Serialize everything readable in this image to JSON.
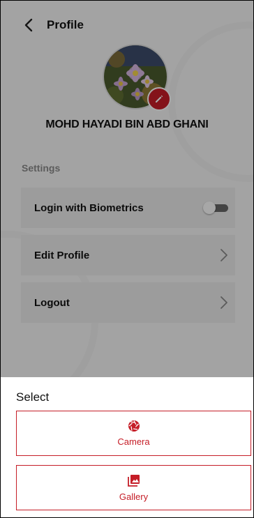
{
  "header": {
    "title": "Profile"
  },
  "profile": {
    "name": "MOHD HAYADI BIN ABD GHANI"
  },
  "settings": {
    "label": "Settings",
    "items": [
      {
        "label": "Login with Biometrics",
        "control": "toggle",
        "toggle_on": false
      },
      {
        "label": "Edit Profile",
        "control": "chevron"
      },
      {
        "label": "Logout",
        "control": "chevron"
      }
    ]
  },
  "sheet": {
    "title": "Select",
    "options": [
      {
        "label": "Camera",
        "icon": "camera-shutter-icon"
      },
      {
        "label": "Gallery",
        "icon": "gallery-icon"
      }
    ]
  },
  "colors": {
    "accent": "#c51d27",
    "background": "#f3f3f3",
    "row": "#e9e9e9"
  }
}
